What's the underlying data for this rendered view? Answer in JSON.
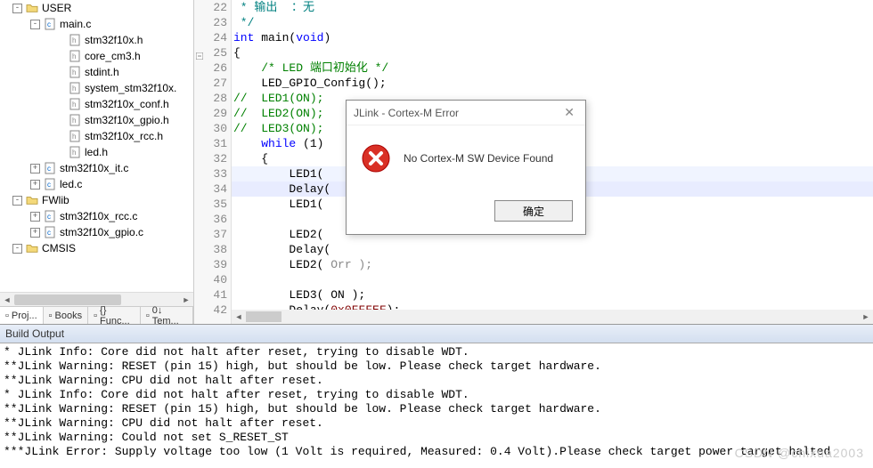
{
  "sidebar": {
    "items": [
      {
        "indent": 10,
        "exp": "-",
        "type": "folder-open",
        "label": "USER"
      },
      {
        "indent": 30,
        "exp": "-",
        "type": "cfile",
        "label": "main.c"
      },
      {
        "indent": 58,
        "exp": "",
        "type": "hfile",
        "label": "stm32f10x.h"
      },
      {
        "indent": 58,
        "exp": "",
        "type": "hfile",
        "label": "core_cm3.h"
      },
      {
        "indent": 58,
        "exp": "",
        "type": "hfile",
        "label": "stdint.h"
      },
      {
        "indent": 58,
        "exp": "",
        "type": "hfile",
        "label": "system_stm32f10x."
      },
      {
        "indent": 58,
        "exp": "",
        "type": "hfile",
        "label": "stm32f10x_conf.h"
      },
      {
        "indent": 58,
        "exp": "",
        "type": "hfile",
        "label": "stm32f10x_gpio.h"
      },
      {
        "indent": 58,
        "exp": "",
        "type": "hfile",
        "label": "stm32f10x_rcc.h"
      },
      {
        "indent": 58,
        "exp": "",
        "type": "hfile",
        "label": "led.h"
      },
      {
        "indent": 30,
        "exp": "+",
        "type": "cfile",
        "label": "stm32f10x_it.c"
      },
      {
        "indent": 30,
        "exp": "+",
        "type": "cfile",
        "label": "led.c"
      },
      {
        "indent": 10,
        "exp": "-",
        "type": "folder",
        "label": "FWlib"
      },
      {
        "indent": 30,
        "exp": "+",
        "type": "cfile",
        "label": "stm32f10x_rcc.c"
      },
      {
        "indent": 30,
        "exp": "+",
        "type": "cfile",
        "label": "stm32f10x_gpio.c"
      },
      {
        "indent": 10,
        "exp": "-",
        "type": "folder",
        "label": "CMSIS"
      }
    ],
    "tabs": [
      {
        "icon": "proj",
        "label": "Proj..."
      },
      {
        "icon": "books",
        "label": "Books"
      },
      {
        "icon": "func",
        "label": "{} Func..."
      },
      {
        "icon": "tem",
        "label": "0↓ Tem..."
      }
    ]
  },
  "editor": {
    "lines": [
      {
        "n": 22,
        "html": "<span class='cmdoc'> * 输出  ：无</span>"
      },
      {
        "n": 23,
        "html": "<span class='cmdoc'> */</span>"
      },
      {
        "n": 24,
        "html": "<span class='kw'>int</span> main(<span class='kw'>void</span>)"
      },
      {
        "n": 25,
        "html": "{",
        "mark": true
      },
      {
        "n": 26,
        "html": "    <span class='cm'>/* LED 端口初始化 */</span>"
      },
      {
        "n": 27,
        "html": "    LED_GPIO_Config();"
      },
      {
        "n": 28,
        "html": "<span class='cm'>//  LED1(ON);</span>"
      },
      {
        "n": 29,
        "html": "<span class='cm'>//  LED2(ON);</span>"
      },
      {
        "n": 30,
        "html": "<span class='cm'>//  LED3(ON);</span>"
      },
      {
        "n": 31,
        "html": "    <span class='kw'>while</span> (1)"
      },
      {
        "n": 32,
        "html": "    {"
      },
      {
        "n": 33,
        "html": "        LED1( ",
        "hl": true
      },
      {
        "n": 34,
        "html": "        Delay(",
        "hl2": true
      },
      {
        "n": 35,
        "html": "        LED1( "
      },
      {
        "n": 36,
        "html": ""
      },
      {
        "n": 37,
        "html": "        LED2( "
      },
      {
        "n": 38,
        "html": "        Delay("
      },
      {
        "n": 39,
        "html": "        LED2( <span style='color:#888'>Orr );</span>"
      },
      {
        "n": 40,
        "html": ""
      },
      {
        "n": 41,
        "html": "        LED3( ON );"
      },
      {
        "n": 42,
        "html": "        Delay(<span class='num'>0x0FFFEF</span>);"
      }
    ]
  },
  "dialog": {
    "title": "JLink - Cortex-M Error",
    "message": "No Cortex-M SW Device Found",
    "ok": "确定"
  },
  "build_output": {
    "title": "Build Output",
    "lines": [
      "* JLink Info: Core did not halt after reset, trying to disable WDT.",
      "**JLink Warning: RESET (pin 15) high, but should be low. Please check target hardware.",
      "**JLink Warning: CPU did not halt after reset.",
      "* JLink Info: Core did not halt after reset, trying to disable WDT.",
      "**JLink Warning: RESET (pin 15) high, but should be low. Please check target hardware.",
      "**JLink Warning: CPU did not halt after reset.",
      "**JLink Warning: Could not set S_RESET_ST",
      "***JLink Error: Supply voltage too low (1 Volt is required, Measured: 0.4 Volt).Please check target power target halted"
    ]
  },
  "watermark": "CSDN @chixua2003"
}
